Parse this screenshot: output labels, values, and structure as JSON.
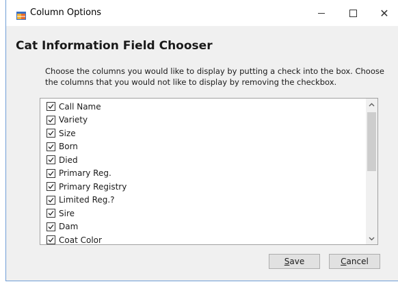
{
  "window": {
    "title": "Column Options",
    "controls": {
      "minimize_icon": "minimize-icon",
      "maximize_icon": "maximize-icon",
      "close_glyph": "✕"
    }
  },
  "heading": "Cat Information Field Chooser",
  "description": "Choose the columns you would like to display by putting a check into the box.  Choose the columns that you would not like to display by removing the checkbox.",
  "columns": [
    {
      "label": "Call Name",
      "checked": true
    },
    {
      "label": "Variety",
      "checked": true
    },
    {
      "label": "Size",
      "checked": true
    },
    {
      "label": "Born",
      "checked": true
    },
    {
      "label": "Died",
      "checked": true
    },
    {
      "label": "Primary Reg.",
      "checked": true
    },
    {
      "label": "Primary Registry",
      "checked": true
    },
    {
      "label": "Limited Reg.?",
      "checked": true
    },
    {
      "label": "Sire",
      "checked": true
    },
    {
      "label": "Dam",
      "checked": true
    },
    {
      "label": "Coat Color",
      "checked": true
    }
  ],
  "buttons": {
    "save": {
      "label": "Save",
      "mnemonic": "S",
      "rest": "ave"
    },
    "cancel": {
      "label": "Cancel",
      "mnemonic": "C",
      "rest": "ancel"
    }
  },
  "colors": {
    "window_border": "#6f9dd6",
    "dialog_bg": "#f0f0f0",
    "button_bg": "#e1e1e1"
  }
}
